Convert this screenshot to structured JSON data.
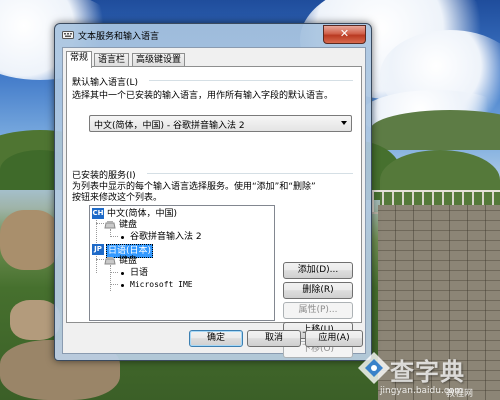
{
  "window": {
    "title": "文本服务和输入语言",
    "close_label": "✕"
  },
  "tabs": [
    {
      "label": "常规",
      "active": true
    },
    {
      "label": "语言栏",
      "active": false
    },
    {
      "label": "高级键设置",
      "active": false
    }
  ],
  "default_language": {
    "heading": "默认输入语言(L)",
    "description": "选择其中一个已安装的输入语言，用作所有输入字段的默认语言。",
    "selected": "中文(简体，中国) - 谷歌拼音输入法 2"
  },
  "installed_services": {
    "heading": "已安装的服务(I)",
    "description_line1": "为列表中显示的每个输入语言选择服务。使用“添加”和“删除”",
    "description_line2": "按钮来修改这个列表。",
    "tree": {
      "lang1": {
        "badge": "CH",
        "label": "中文(简体，中国)"
      },
      "lang1_group": "键盘",
      "lang1_item1": "谷歌拼音输入法 2",
      "lang2": {
        "badge": "JP",
        "label": "日语(日本)"
      },
      "lang2_group": "键盘",
      "lang2_item1": "日语",
      "lang2_item2": "Microsoft IME"
    }
  },
  "side_buttons": {
    "add": "添加(D)...",
    "remove": "删除(R)",
    "properties": "属性(P)...",
    "move_up": "上移(U)",
    "move_down": "下移(O)"
  },
  "footer_buttons": {
    "ok": "确定",
    "cancel": "取消",
    "apply": "应用(A)"
  },
  "watermark": {
    "text": "查字典",
    "url": "jingyan.baidu.com",
    "sub": "教程网"
  }
}
